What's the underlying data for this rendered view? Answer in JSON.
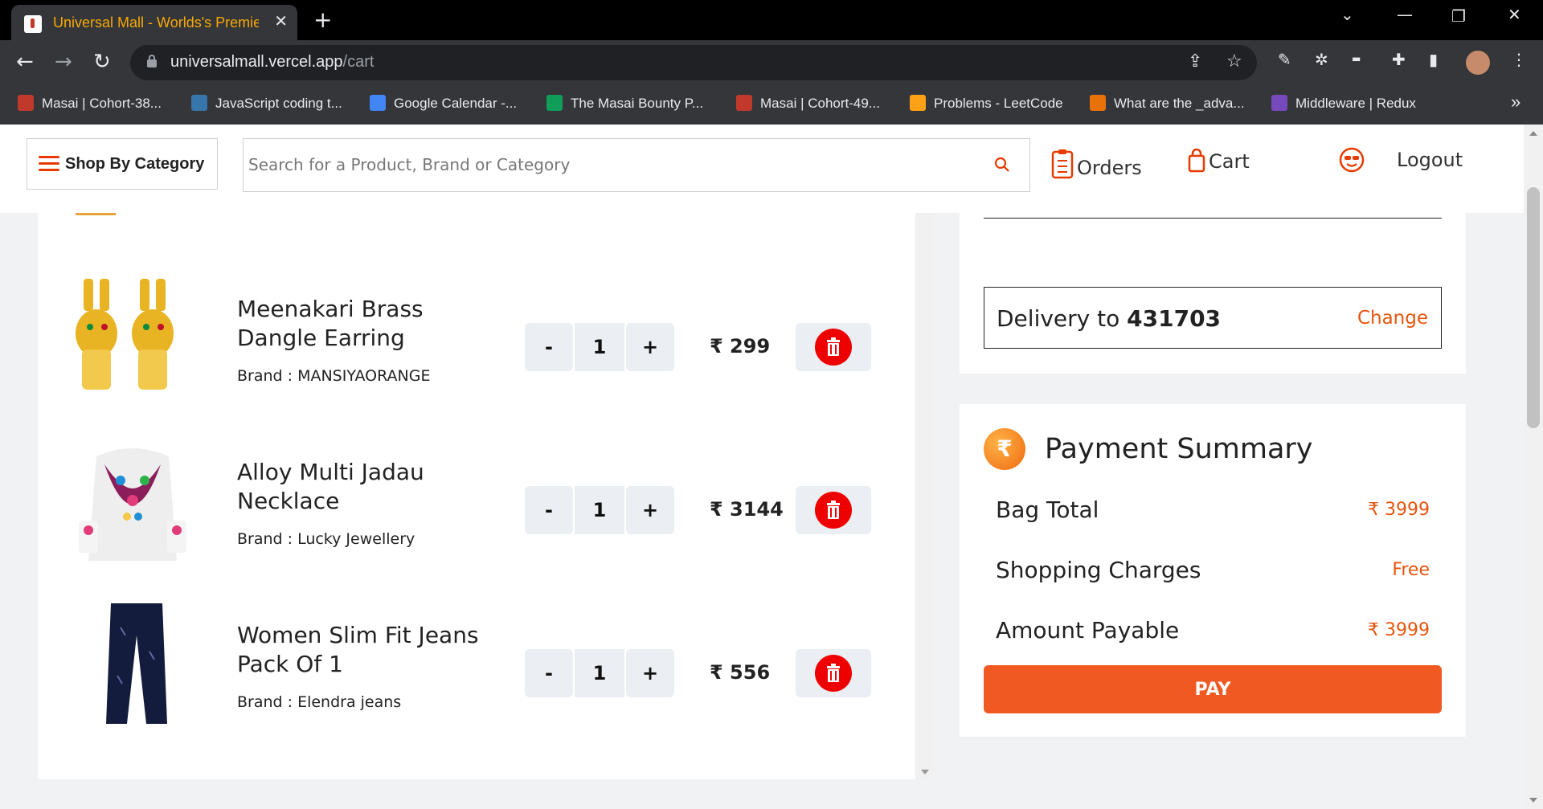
{
  "browser": {
    "tab_title": "Universal Mall - Worlds's Premier",
    "url_host": "universalmall.vercel.app",
    "url_path": "/cart",
    "bookmarks": [
      {
        "label": "Masai | Cohort-38...",
        "icon": "masai-icon",
        "color": "#c0392b"
      },
      {
        "label": "JavaScript coding t...",
        "icon": "python-icon",
        "color": "#3776ab"
      },
      {
        "label": "Google Calendar -...",
        "icon": "calendar-icon",
        "color": "#4285f4"
      },
      {
        "label": "The Masai Bounty P...",
        "icon": "sheets-icon",
        "color": "#0f9d58"
      },
      {
        "label": "Masai | Cohort-49...",
        "icon": "masai-icon",
        "color": "#c0392b"
      },
      {
        "label": "Problems - LeetCode",
        "icon": "leetcode-icon",
        "color": "#ffa116"
      },
      {
        "label": "What are the _adva...",
        "icon": "site-icon",
        "color": "#e8710a"
      },
      {
        "label": "Middleware | Redux",
        "icon": "redux-icon",
        "color": "#764abc"
      }
    ],
    "overflow": "»"
  },
  "header": {
    "category_label": "Shop By Category",
    "search_placeholder": "Search for a Product, Brand or Category",
    "orders_label": "Orders",
    "cart_label": "Cart",
    "logout_label": "Logout",
    "accent": "#e63a00"
  },
  "cart": {
    "items": [
      {
        "name": "Meenakari Brass Dangle Earring",
        "brand": "Brand : MANSIYAORANGE",
        "qty": "1",
        "price": "₹ 299",
        "minus": "-",
        "plus": "+"
      },
      {
        "name": "Alloy Multi Jadau Necklace",
        "brand": "Brand : Lucky Jewellery",
        "qty": "1",
        "price": "₹ 3144",
        "minus": "-",
        "plus": "+"
      },
      {
        "name": "Women Slim Fit Jeans Pack Of 1",
        "brand": "Brand : Elendra jeans",
        "qty": "1",
        "price": "₹ 556",
        "minus": "-",
        "plus": "+"
      }
    ]
  },
  "delivery": {
    "prefix": "Delivery to",
    "pincode": "431703",
    "change_label": "Change"
  },
  "summary": {
    "badge": "₹",
    "title": "Payment Summary",
    "bag_total_label": "Bag Total",
    "bag_total": "₹ 3999",
    "shipping_label": "Shopping Charges",
    "shipping": "Free",
    "payable_label": "Amount Payable",
    "payable": "₹ 3999",
    "pay_label": "PAY",
    "pay_color": "#f05a22"
  }
}
